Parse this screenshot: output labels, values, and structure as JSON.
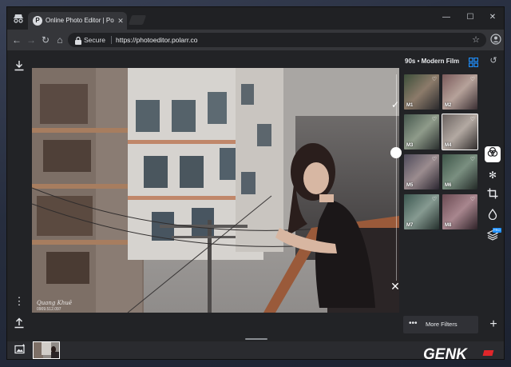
{
  "browser": {
    "tab_title": "Online Photo Editor | Pola",
    "tab_favicon": "P",
    "secure_label": "Secure",
    "url": "https://photoeditor.polarr.co"
  },
  "icons": {
    "incognito": "incognito-icon",
    "close": "close-icon",
    "minimize": "minimize-icon",
    "maximize": "maximize-icon",
    "back": "back-icon",
    "forward": "forward-icon",
    "reload": "reload-icon",
    "home": "home-icon",
    "lock": "lock-icon",
    "star": "star-icon",
    "download": "download-icon",
    "more": "more-vertical-icon",
    "share": "share-icon",
    "gallery": "gallery-icon",
    "check": "check-icon",
    "grid": "grid-icon",
    "history": "history-icon",
    "add": "plus-icon"
  },
  "editor": {
    "panel_title": "90s • Modern Film",
    "more_filters": "More Filters",
    "filters": [
      {
        "label": "M1"
      },
      {
        "label": "M2"
      },
      {
        "label": "M3"
      },
      {
        "label": "M4"
      },
      {
        "label": "M5"
      },
      {
        "label": "M6"
      },
      {
        "label": "M7"
      },
      {
        "label": "M8"
      }
    ],
    "selected_filter": "M4",
    "intensity": 0.62,
    "tools": [
      "filters-icon",
      "adjust-icon",
      "crop-icon",
      "retouch-icon",
      "layers-icon"
    ],
    "tool_badge": "PRO"
  },
  "photo": {
    "watermark_name": "Quang Khuê",
    "watermark_phone": "0909.512.097"
  },
  "site_logo": "GENK",
  "colors": {
    "app_bg": "#222326",
    "accent_blue": "#1e90ff",
    "logo_red": "#e0262a"
  }
}
